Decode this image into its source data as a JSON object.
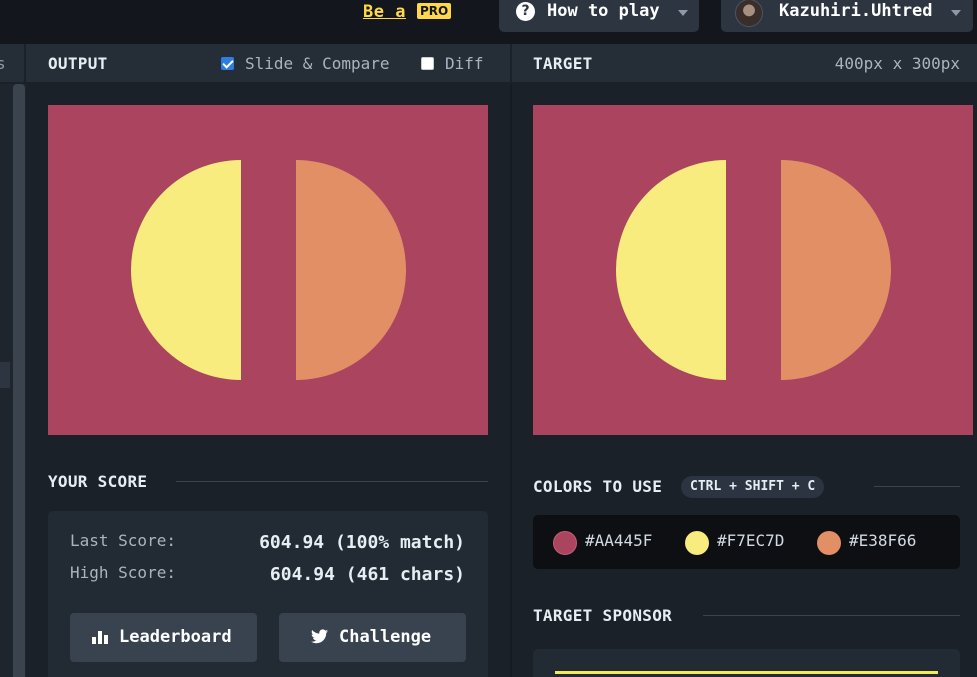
{
  "topbar": {
    "be_a": "Be a",
    "pro_badge": "PRO",
    "how_to_play": "How to play",
    "username": "Kazuhiri.Uhtred"
  },
  "output_panel": {
    "title": "OUTPUT",
    "slide_compare_label": "Slide & Compare",
    "slide_compare_checked": true,
    "diff_label": "Diff",
    "diff_checked": false
  },
  "target_panel": {
    "title": "TARGET",
    "dimensions": "400px x 300px"
  },
  "score": {
    "title": "YOUR SCORE",
    "last_label": "Last Score:",
    "last_value": "604.94 (100% match)",
    "high_label": "High Score:",
    "high_value": "604.94 (461 chars)",
    "leaderboard_label": "Leaderboard",
    "challenge_label": "Challenge"
  },
  "colors": {
    "title": "COLORS TO USE",
    "shortcut": "CTRL + SHIFT + C",
    "items": [
      {
        "hex": "#AA445F",
        "color": "#aa445f"
      },
      {
        "hex": "#F7EC7D",
        "color": "#f7ec7d"
      },
      {
        "hex": "#E38F66",
        "color": "#e38f66"
      }
    ]
  },
  "sponsor": {
    "title": "TARGET SPONSOR"
  },
  "icons": {
    "help": "question-circle-icon",
    "dropdown": "chevron-down-icon",
    "leaderboard": "bar-chart-icon",
    "challenge": "twitter-icon"
  }
}
